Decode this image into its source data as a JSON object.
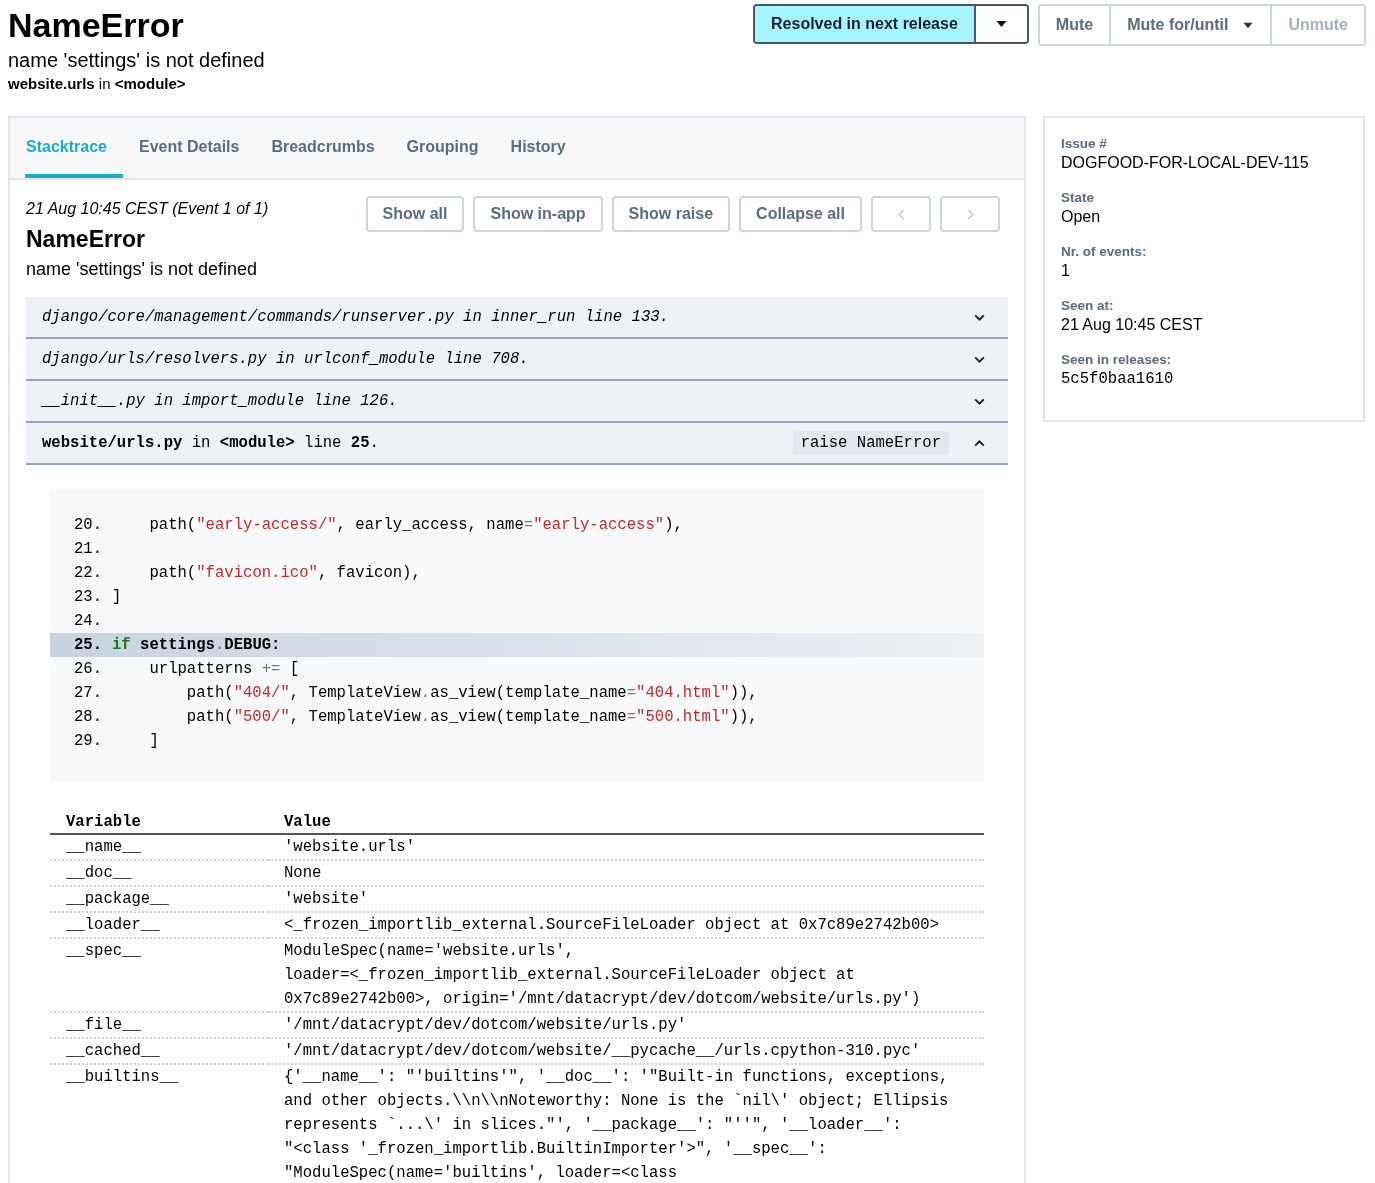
{
  "issue": {
    "title": "NameError",
    "message": "name 'settings' is not defined",
    "location": "**website.urls** in **<module>**"
  },
  "actions": {
    "resolve": {
      "label": "Resolved in next release",
      "selected": true
    },
    "mute_buttons": [
      {
        "label": "Mute",
        "disabled": false,
        "dropdown": false
      },
      {
        "label": "Mute for/until",
        "disabled": false,
        "dropdown": true
      },
      {
        "label": "Unmute",
        "disabled": true,
        "dropdown": false
      }
    ]
  },
  "tabs": [
    {
      "label": "Stacktrace",
      "selected": true
    },
    {
      "label": "Event Details",
      "selected": false
    },
    {
      "label": "Breadcrumbs",
      "selected": false
    },
    {
      "label": "Grouping",
      "selected": false
    },
    {
      "label": "History",
      "selected": false
    }
  ],
  "event": {
    "timestamp": "21 Aug 10:45 CEST (Event 1 of 1)",
    "title": "NameError",
    "message": "name 'settings' is not defined",
    "buttons": [
      {
        "kind": "text",
        "label": "Show all",
        "disabled": false
      },
      {
        "kind": "text",
        "label": "Show in-app",
        "disabled": false
      },
      {
        "kind": "text",
        "label": "Show raise",
        "disabled": false
      },
      {
        "kind": "text",
        "label": "Collapse all",
        "disabled": false
      },
      {
        "kind": "prev",
        "disabled": true
      },
      {
        "kind": "next",
        "disabled": true
      }
    ]
  },
  "frames": [
    {
      "text": "django/core/management/commands/runserver.py in inner_run line 133.",
      "in_app": false,
      "expanded": false
    },
    {
      "text": "django/urls/resolvers.py in urlconf_module line 708.",
      "in_app": false,
      "expanded": false
    },
    {
      "text": "__init__.py in import_module line 126.",
      "in_app": false,
      "expanded": false
    },
    {
      "text": "**website/urls.py** in **<module>** line **25**.",
      "in_app": true,
      "expanded": true,
      "badge": "raise NameError"
    }
  ],
  "code_lines": [
    {
      "number": "20.",
      "selected": false,
      "tokens": [
        {
          "kind": "plain",
          "text": "    path("
        },
        {
          "kind": "string",
          "text": "\"early-access/\""
        },
        {
          "kind": "plain",
          "text": ", early_access, name"
        },
        {
          "kind": "operator",
          "text": "="
        },
        {
          "kind": "string",
          "text": "\"early-access\""
        },
        {
          "kind": "plain",
          "text": "),"
        }
      ]
    },
    {
      "number": "21.",
      "selected": false
    },
    {
      "number": "22.",
      "selected": false,
      "tokens": [
        {
          "kind": "plain",
          "text": "    path("
        },
        {
          "kind": "string",
          "text": "\"favicon.ico\""
        },
        {
          "kind": "plain",
          "text": ", favicon),"
        }
      ]
    },
    {
      "number": "23.",
      "selected": false,
      "tokens": [
        {
          "kind": "plain",
          "text": "]"
        }
      ]
    },
    {
      "number": "24.",
      "selected": false
    },
    {
      "number": "25.",
      "selected": true,
      "tokens": [
        {
          "kind": "keyword",
          "text": "if"
        },
        {
          "kind": "plain",
          "text": " settings"
        },
        {
          "kind": "operator",
          "text": "."
        },
        {
          "kind": "plain",
          "text": "DEBUG:"
        }
      ]
    },
    {
      "number": "26.",
      "selected": false,
      "tokens": [
        {
          "kind": "plain",
          "text": "    urlpatterns "
        },
        {
          "kind": "operator",
          "text": "+="
        },
        {
          "kind": "plain",
          "text": " ["
        }
      ]
    },
    {
      "number": "27.",
      "selected": false,
      "tokens": [
        {
          "kind": "plain",
          "text": "        path("
        },
        {
          "kind": "string",
          "text": "\"404/\""
        },
        {
          "kind": "plain",
          "text": ", TemplateView"
        },
        {
          "kind": "operator",
          "text": "."
        },
        {
          "kind": "plain",
          "text": "as_view(template_name"
        },
        {
          "kind": "operator",
          "text": "="
        },
        {
          "kind": "string",
          "text": "\"404.html\""
        },
        {
          "kind": "plain",
          "text": ")),"
        }
      ]
    },
    {
      "number": "28.",
      "selected": false,
      "tokens": [
        {
          "kind": "plain",
          "text": "        path("
        },
        {
          "kind": "string",
          "text": "\"500/\""
        },
        {
          "kind": "plain",
          "text": ", TemplateView"
        },
        {
          "kind": "operator",
          "text": "."
        },
        {
          "kind": "plain",
          "text": "as_view(template_name"
        },
        {
          "kind": "operator",
          "text": "="
        },
        {
          "kind": "string",
          "text": "\"500.html\""
        },
        {
          "kind": "plain",
          "text": ")),"
        }
      ]
    },
    {
      "number": "29.",
      "selected": false,
      "tokens": [
        {
          "kind": "plain",
          "text": "    ]"
        }
      ]
    }
  ],
  "variables": {
    "columns": [
      "Variable",
      "Value"
    ],
    "rows": [
      {
        "name": "__name__",
        "value_lines": [
          "'website.urls'"
        ]
      },
      {
        "name": "__doc__",
        "value_lines": [
          "None"
        ]
      },
      {
        "name": "__package__",
        "value_lines": [
          "'website'"
        ]
      },
      {
        "name": "__loader__",
        "value_lines": [
          "<_frozen_importlib_external.SourceFileLoader object at 0x7c89e2742b00>"
        ]
      },
      {
        "name": "__spec__",
        "value_lines": [
          "ModuleSpec(name='website.urls',",
          "loader=<_frozen_importlib_external.SourceFileLoader object at",
          "0x7c89e2742b00>, origin='/mnt/datacrypt/dev/dotcom/website/urls.py')"
        ]
      },
      {
        "name": "__file__",
        "value_lines": [
          "'/mnt/datacrypt/dev/dotcom/website/urls.py'"
        ]
      },
      {
        "name": "__cached__",
        "value_lines": [
          "'/mnt/datacrypt/dev/dotcom/website/__pycache__/urls.cpython-310.pyc'"
        ]
      },
      {
        "name": "__builtins__",
        "value_lines": [
          "{'__name__': \"'builtins'\", '__doc__': '\"Built-in functions, exceptions,",
          "and other objects.\\\\n\\\\nNoteworthy: None is the `nil\\' object; Ellipsis",
          "represents `...\\' in slices.\"', '__package__': \"''\", '__loader__':",
          "\"<class '_frozen_importlib.BuiltinImporter'>\", '__spec__':",
          "\"ModuleSpec(name='builtins', loader=<class"
        ]
      }
    ]
  },
  "sidebar": {
    "fields": [
      {
        "label": "Issue #",
        "value": "DOGFOOD-FOR-LOCAL-DEV-115",
        "mono": false
      },
      {
        "label": "State",
        "value": "Open",
        "mono": false
      },
      {
        "label": "Nr. of events:",
        "value": "1",
        "mono": false
      },
      {
        "label": "Seen at:",
        "value": "21 Aug 10:45 CEST",
        "mono": false
      },
      {
        "label": "Seen in releases:",
        "value": "5c5f0baa1610",
        "mono": true
      }
    ]
  }
}
